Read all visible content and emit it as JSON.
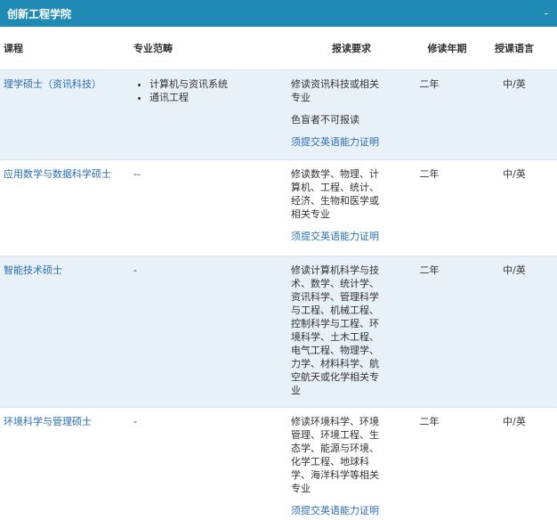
{
  "header": {
    "title": "创新工程学院",
    "toggle": "-"
  },
  "columns": [
    "课程",
    "专业范畴",
    "报读要求",
    "修读年期",
    "授课语言"
  ],
  "rows": [
    {
      "course": "理学硕士（资讯科技）",
      "fields": [
        "计算机与资讯系统",
        "通讯工程"
      ],
      "requirements": [
        "修读资讯科技或相关专业",
        "色盲者不可报读"
      ],
      "req_link": "须提交英语能力证明",
      "duration": "二年",
      "language": "中/英"
    },
    {
      "course": "应用数学与数据科学硕士",
      "fields_text": "--",
      "requirements": [
        "修读数学、物理、计算机、工程、统计、经济、生物和医学或相关专业"
      ],
      "req_link": "须提交英语能力证明",
      "duration": "二年",
      "language": "中/英"
    },
    {
      "course": "智能技术硕士",
      "fields_text": "-",
      "requirements": [
        "修读计算机科学与技术、数学、统计学、资讯科学、管理科学与工程、机械工程、控制科学与工程、环境科学、土木工程、电气工程、物理学、力学、材料科学、航空航天或化学相关专业"
      ],
      "duration": "二年",
      "language": "中/英"
    },
    {
      "course": "环境科学与管理硕士",
      "fields_text": "-",
      "requirements": [
        "修读环境科学、环境管理、环境工程、生态学、能源与环境、化学工程、地球科学、海洋科学等相关专业"
      ],
      "req_link": "须提交英语能力证明",
      "duration": "二年",
      "language": "中/英"
    }
  ]
}
